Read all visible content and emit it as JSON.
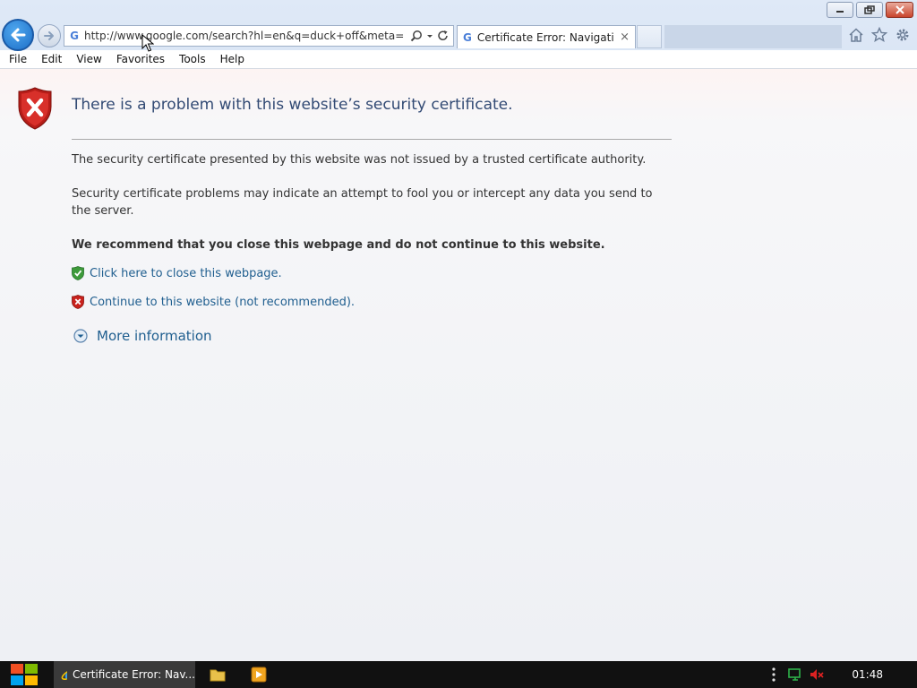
{
  "window": {
    "controls": [
      "minimize",
      "restore",
      "close"
    ]
  },
  "toolbar": {
    "address_url": "http://www.google.com/search?hl=en&q=duck+off&meta=",
    "address_icon": "G",
    "tab_title": "Certificate Error: Navigatio...",
    "tab_icon": "G",
    "tab_close": "×"
  },
  "menu": {
    "items": [
      "File",
      "Edit",
      "View",
      "Favorites",
      "Tools",
      "Help"
    ]
  },
  "page": {
    "title": "There is a problem with this website’s security certificate.",
    "paragraph1": "The security certificate presented by this website was not issued by a trusted certificate authority.",
    "paragraph2": "Security certificate problems may indicate an attempt to fool you or intercept any data you send to the server.",
    "recommendation": "We recommend that you close this webpage and do not continue to this website.",
    "close_link": "Click here to close this webpage.",
    "continue_link": "Continue to this website (not recommended).",
    "more_info": "More information"
  },
  "taskbar": {
    "active_window_label": "Certificate Error: Nav...",
    "clock": "01:48"
  },
  "colors": {
    "link": "#1f5e8f",
    "title": "#324a74",
    "shield_red": "#c8211c",
    "shield_green": "#3d9a3a"
  }
}
